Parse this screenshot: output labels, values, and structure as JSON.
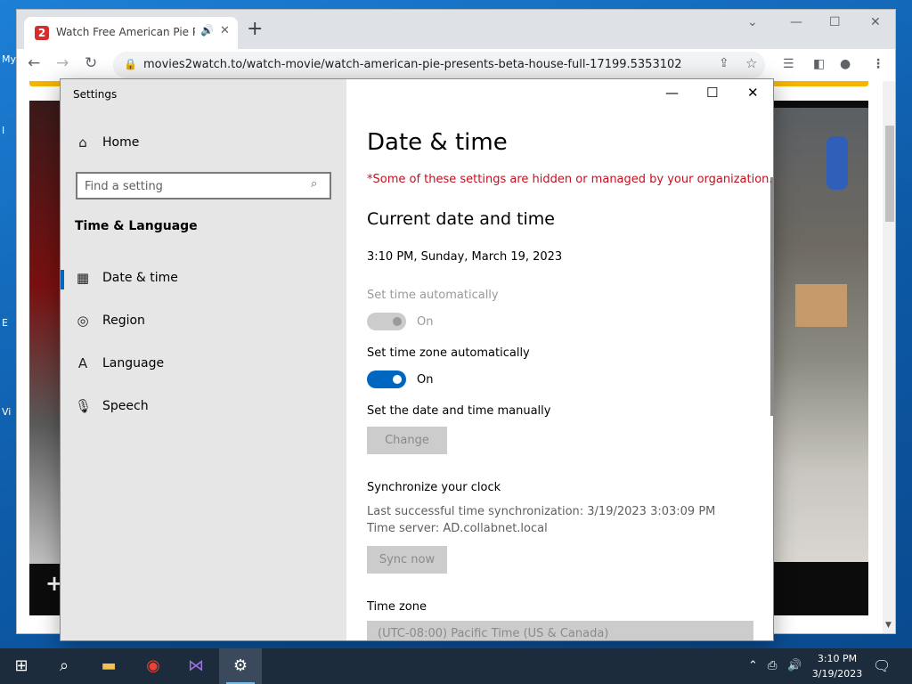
{
  "desktop": {
    "peeks": [
      "My",
      "I",
      "E",
      "Vi"
    ]
  },
  "chrome": {
    "tab": {
      "title": "Watch Free American Pie Presents Beta House",
      "favicon_text": "2",
      "audio_icon": "speaker-icon",
      "close_icon": "close-icon"
    },
    "new_tab_icon": "plus-icon",
    "window_controls": [
      "chevron-down-icon",
      "minimize-icon",
      "maximize-icon",
      "close-icon"
    ],
    "url": "movies2watch.to/watch-movie/watch-american-pie-presents-beta-house-full-17199.5353102",
    "nav_icons": [
      "back-icon",
      "forward-icon",
      "reload-icon"
    ],
    "toolbar_icons": [
      "share-icon",
      "star-icon",
      "reading-list-icon",
      "sidebar-icon",
      "profile-icon",
      "menu-icon"
    ]
  },
  "settings": {
    "app_title": "Settings",
    "sidebar": {
      "home_label": "Home",
      "search_placeholder": "Find a setting",
      "section_title": "Time & Language",
      "items": [
        {
          "label": "Date & time",
          "icon": "calendar-clock-icon",
          "active": true
        },
        {
          "label": "Region",
          "icon": "globe-icon",
          "active": false
        },
        {
          "label": "Language",
          "icon": "language-icon",
          "active": false
        },
        {
          "label": "Speech",
          "icon": "microphone-icon",
          "active": false
        }
      ]
    },
    "content": {
      "title": "Date & time",
      "org_notice": "*Some of these settings are hidden or managed by your organization.",
      "current_heading": "Current date and time",
      "current_datetime": "3:10 PM, Sunday, March 19, 2023",
      "set_time_auto_label": "Set time automatically",
      "set_time_auto_state": "On",
      "set_tz_auto_label": "Set time zone automatically",
      "set_tz_auto_state": "On",
      "manual_label": "Set the date and time manually",
      "change_button": "Change",
      "sync_heading": "Synchronize your clock",
      "last_sync": "Last successful time synchronization: 3/19/2023 3:03:09 PM",
      "time_server": "Time server: AD.collabnet.local",
      "sync_button": "Sync now",
      "timezone_heading": "Time zone",
      "timezone_value": "(UTC-08:00) Pacific Time (US & Canada)"
    }
  },
  "taskbar": {
    "apps": [
      "windows-start-icon",
      "search-icon",
      "file-explorer-icon",
      "chrome-icon",
      "visual-studio-icon",
      "settings-gear-icon"
    ],
    "clock_time": "3:10 PM",
    "clock_date": "3/19/2023"
  }
}
